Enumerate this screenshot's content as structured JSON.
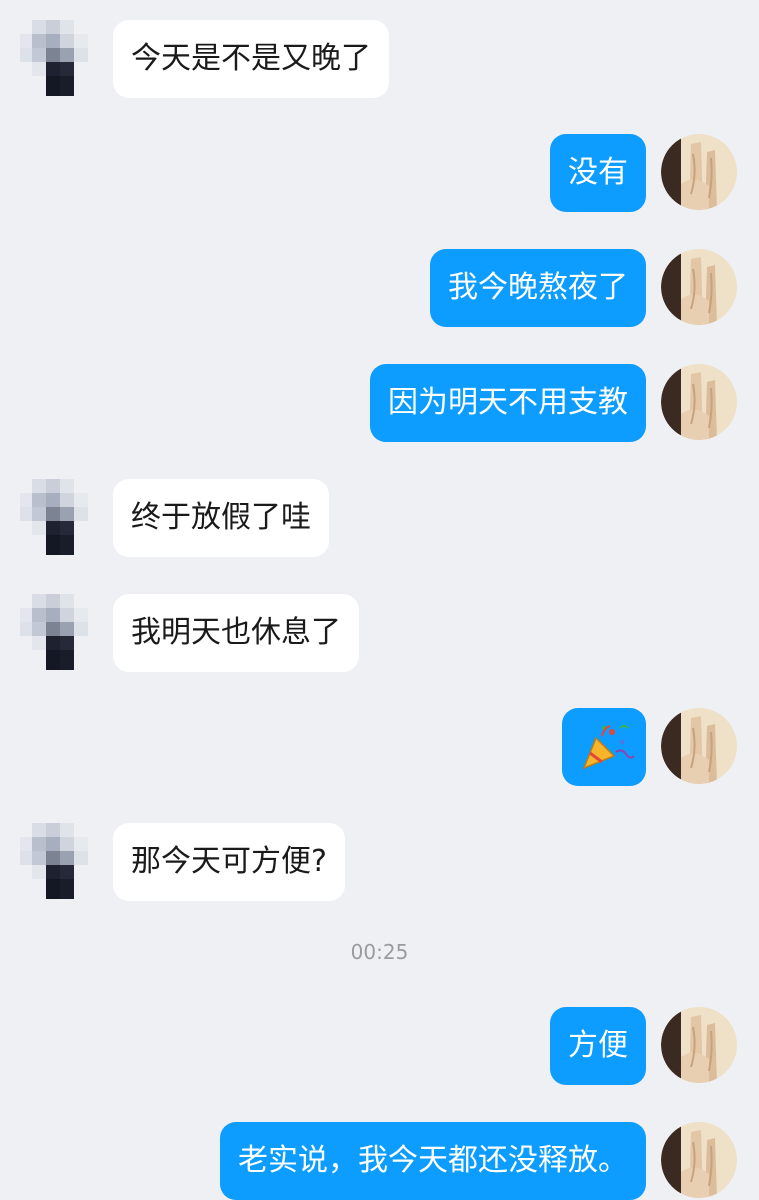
{
  "colors": {
    "background": "#eff0f4",
    "outgoing_bubble": "#0d9cff",
    "incoming_bubble": "#ffffff"
  },
  "messages": [
    {
      "side": "in",
      "text": "今天是不是又晚了"
    },
    {
      "side": "out",
      "text": "没有"
    },
    {
      "side": "out",
      "text": "我今晚熬夜了"
    },
    {
      "side": "out",
      "text": "因为明天不用支教"
    },
    {
      "side": "in",
      "text": "终于放假了哇"
    },
    {
      "side": "in",
      "text": "我明天也休息了"
    },
    {
      "side": "out",
      "text": "🎉",
      "icon": "party-popper-emoji"
    },
    {
      "side": "in",
      "text": "那今天可方便?"
    },
    {
      "side": "out",
      "text": "方便"
    },
    {
      "side": "out",
      "text": "老实说，我今天都还没释放。"
    }
  ],
  "timestamp": "00:25"
}
